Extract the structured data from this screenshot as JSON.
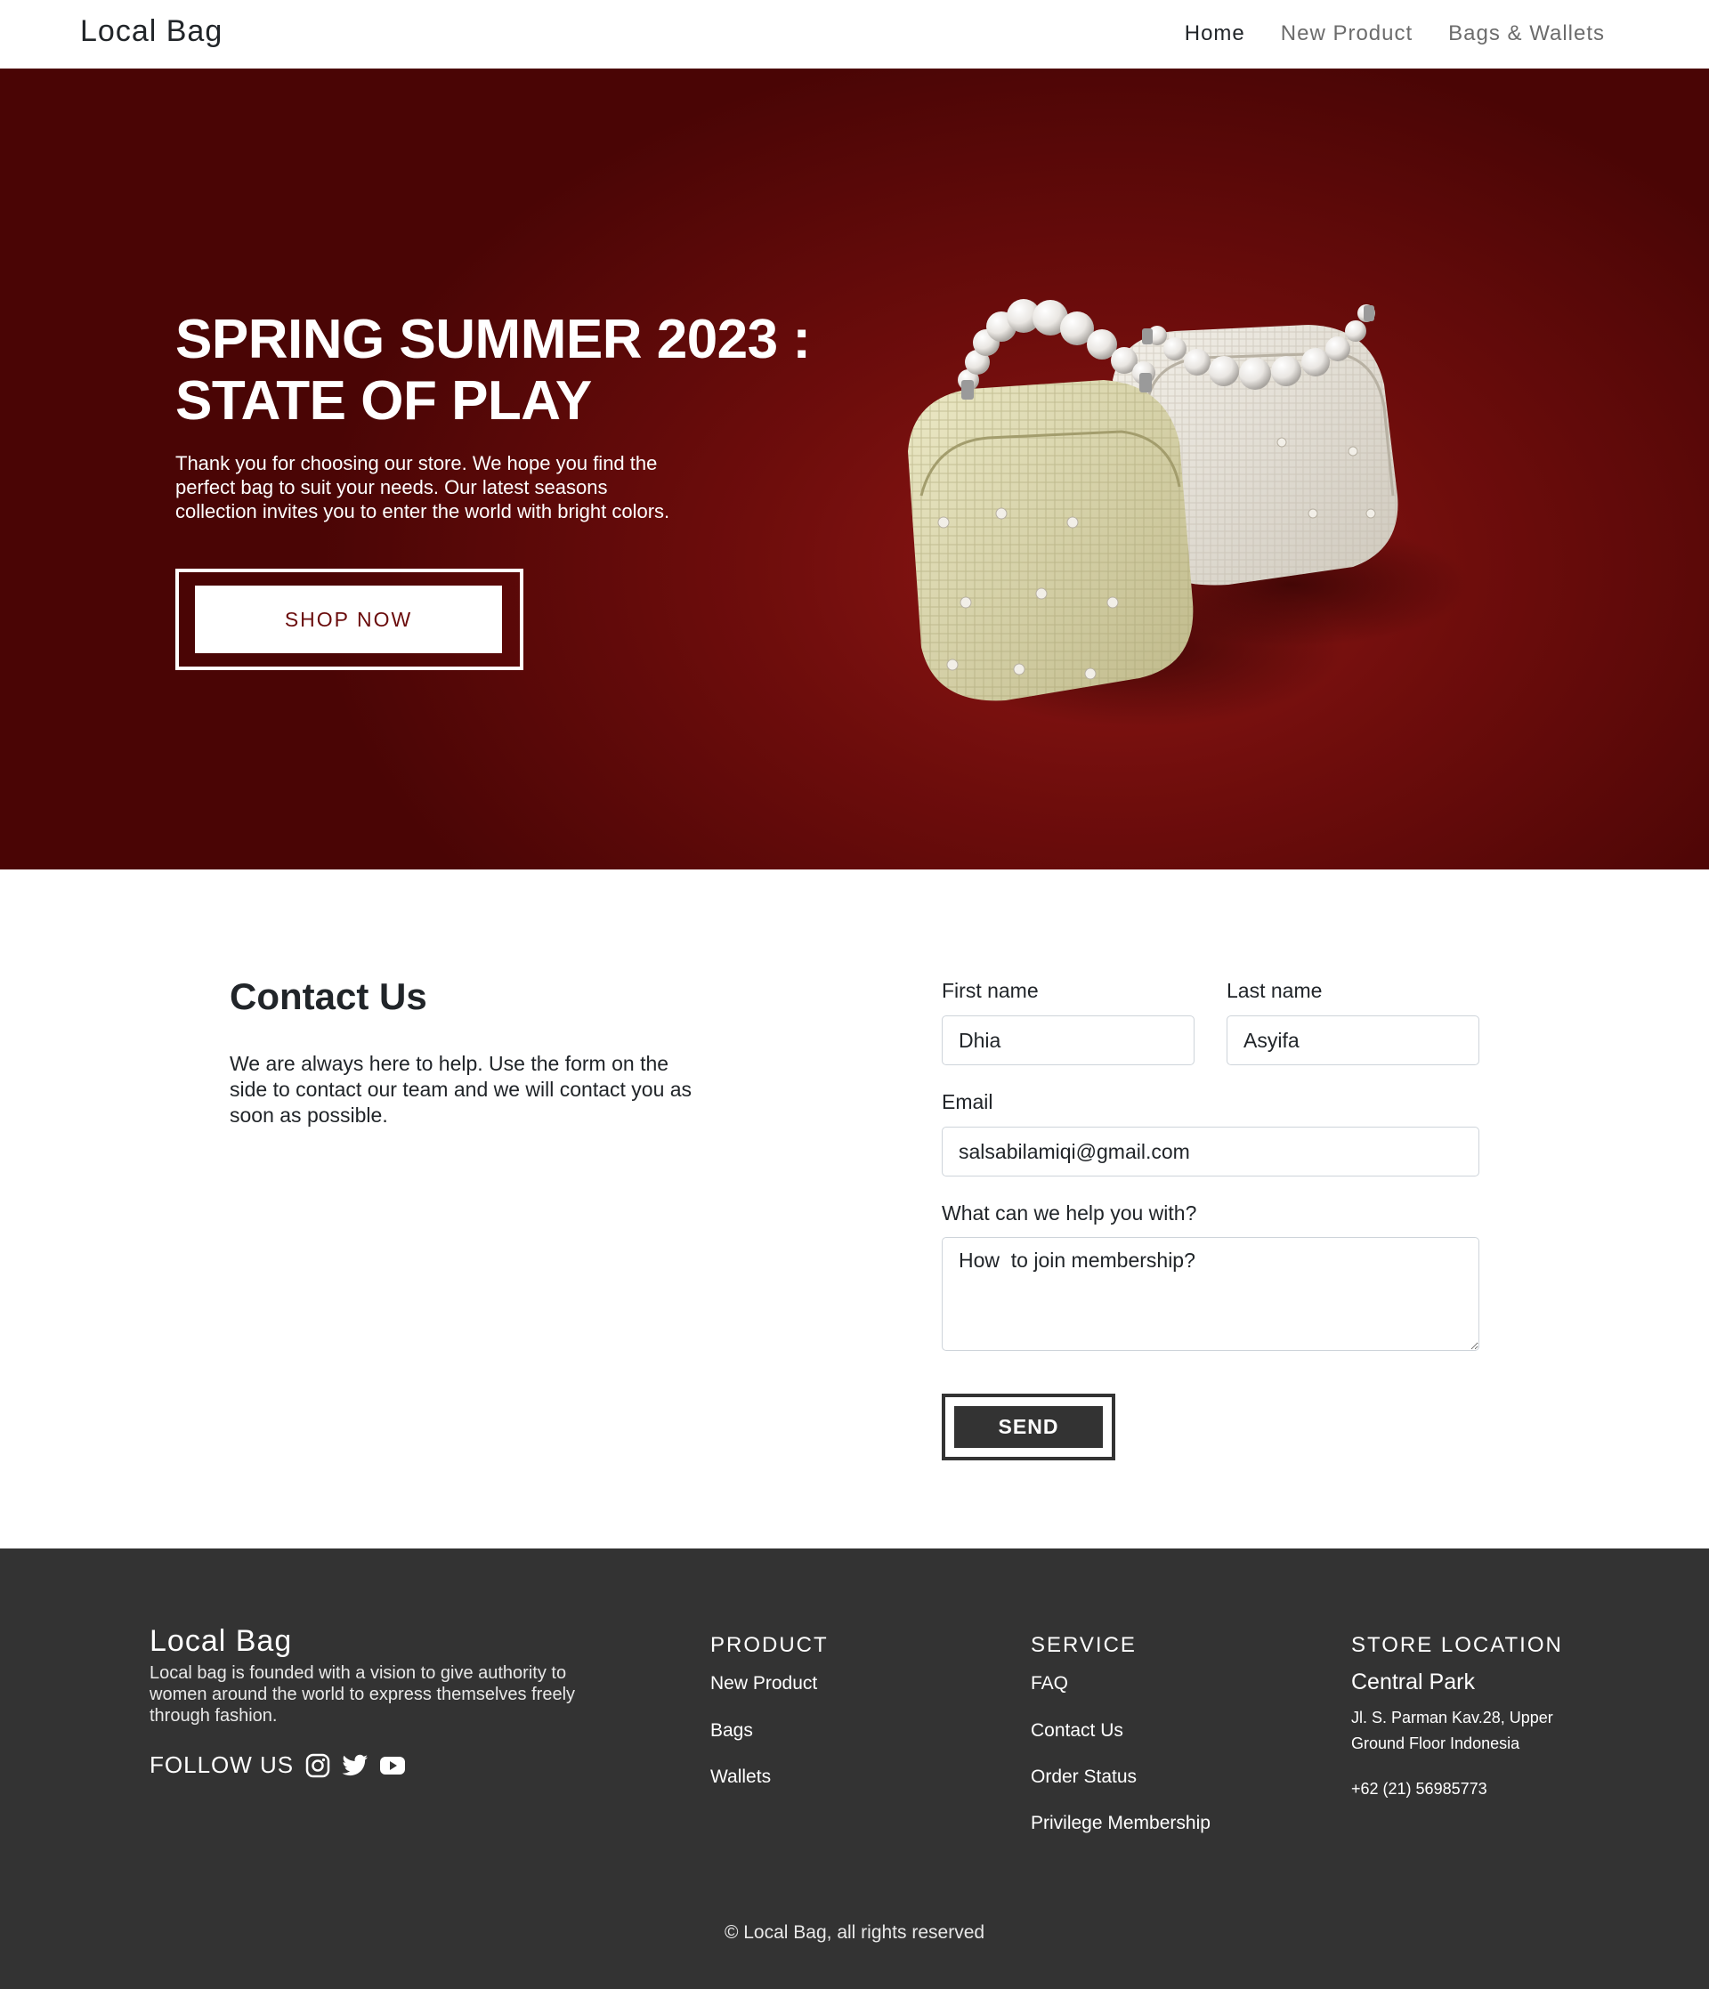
{
  "nav": {
    "brand": "Local Bag",
    "links": [
      {
        "label": "Home",
        "active": true
      },
      {
        "label": "New Product",
        "active": false
      },
      {
        "label": "Bags & Wallets",
        "active": false
      }
    ]
  },
  "hero": {
    "title_line1": "SPRING SUMMER 2023 :",
    "title_line2": "STATE OF PLAY",
    "description": "Thank you for choosing our store. We hope you find the perfect bag to suit your needs. Our latest seasons collection invites you to enter the world with bright colors.",
    "cta_label": "SHOP NOW",
    "image_alt": "two-tweed-bags-with-pearl-handles",
    "colors": {
      "bg": "#6e0d0c",
      "cta_text": "#6a0b0b"
    }
  },
  "contact": {
    "title": "Contact Us",
    "description": "We are always here to help. Use the form on the side to contact our team and we will contact you as soon as possible.",
    "form": {
      "first_name_label": "First name",
      "first_name_value": "Dhia",
      "last_name_label": "Last name",
      "last_name_value": "Asyifa",
      "email_label": "Email",
      "email_value": "salsabilamiqi@gmail.com",
      "message_label": "What can we help you with?",
      "message_value": "How  to join membership?",
      "send_label": "SEND"
    }
  },
  "footer": {
    "brand": "Local Bag",
    "about": "Local bag is founded with a vision to give authority to women around the world to express themselves freely through fashion.",
    "follow_label": "FOLLOW US",
    "social_icons": [
      "instagram-icon",
      "twitter-icon",
      "youtube-icon"
    ],
    "product": {
      "title": "PRODUCT",
      "links": [
        "New Product",
        "Bags",
        "Wallets"
      ]
    },
    "service": {
      "title": "SERVICE",
      "links": [
        "FAQ",
        "Contact Us",
        "Order Status",
        "Privilege Membership"
      ]
    },
    "store": {
      "title": "STORE LOCATION",
      "name": "Central Park",
      "address": "Jl. S. Parman Kav.28, Upper Ground Floor Indonesia",
      "phone": "+62 (21) 56985773"
    },
    "copyright": "© Local Bag, all rights reserved",
    "colors": {
      "bg": "#333333"
    }
  }
}
